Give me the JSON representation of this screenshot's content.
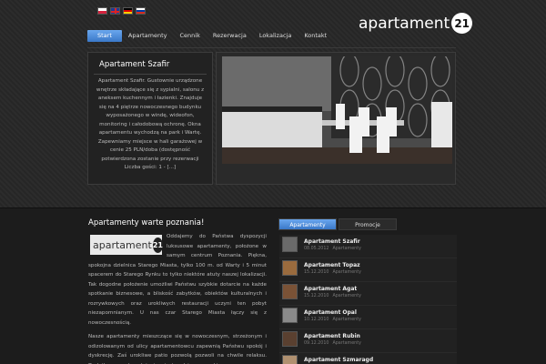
{
  "languages": [
    "pl",
    "en",
    "de",
    "ru"
  ],
  "logo": {
    "word": "apartament",
    "number": "21"
  },
  "nav": {
    "items": [
      "Start",
      "Apartamenty",
      "Cennik",
      "Rezerwacja",
      "Lokalizacja",
      "Kontakt"
    ],
    "active": "Start"
  },
  "featured": {
    "title": "Apartament Szafir",
    "text": "Apartament Szafir. Gustownie urządzone wnętrze składające się z sypialni, salonu z aneksem kuchennym i łazienki. Znajduje się na 4 piętrze nowoczesnego budynku wyposażonego w windę, wideofon, monitoring i całodobową ochronę. Okna apartamentu wychodzą na park i Wartę. Zapewniamy miejsce w hali garażowej w cenie 25 PLN/doba (dostępność potwierdzona zostanie przy rezerwacji Liczba gości: 1 - [...]"
  },
  "content": {
    "title": "Apartamenty warte poznania!",
    "paragraph1": "Oddajemy do Państwa dyspozycji luksusowe apartamenty, położone w samym centrum Poznania. Piękna, spokojna dzielnica Starego Miasta, tylko 100 m. od Warty i 5 minut spacerem do Starego Rynku to tylko niektóre atuty naszej lokalizacji. Tak dogodne położenie umożliwi Państwu szybkie dotarcie na każde spotkanie biznesowe, a bliskość zabytków, obiektów kulturalnych i rozrywkowych oraz urokliwych restauracji uczyni ten pobyt niezapomnianym. U nas czar Starego Miasta łączy się z nowoczesnością.",
    "paragraph2": "Nasze apartamenty mieszczące się w nowoczesnym, strzeżonym i odizolowanym od ulicy apartamentowcu zapewnią Państwu spokój i dyskrecję. Zaś urokliwe patio pozwolą pozwoli na chwile relaksu. Dodatkowym udogodnieniem jest podziemny parking."
  },
  "sidebar": {
    "tabs": [
      "Apartamenty",
      "Promocje"
    ],
    "active_tab": "Apartamenty",
    "items": [
      {
        "title": "Apartament Szafir",
        "date": "08.05.2012",
        "category": "Apartamenty"
      },
      {
        "title": "Apartament Topaz",
        "date": "15.12.2010",
        "category": "Apartamenty"
      },
      {
        "title": "Apartament Agat",
        "date": "15.12.2010",
        "category": "Apartamenty"
      },
      {
        "title": "Apartament Opal",
        "date": "10.12.2010",
        "category": "Apartamenty"
      },
      {
        "title": "Apartament Rubin",
        "date": "09.12.2010",
        "category": "Apartamenty"
      },
      {
        "title": "Apartament Szmaragd",
        "date": "",
        "category": ""
      }
    ]
  }
}
